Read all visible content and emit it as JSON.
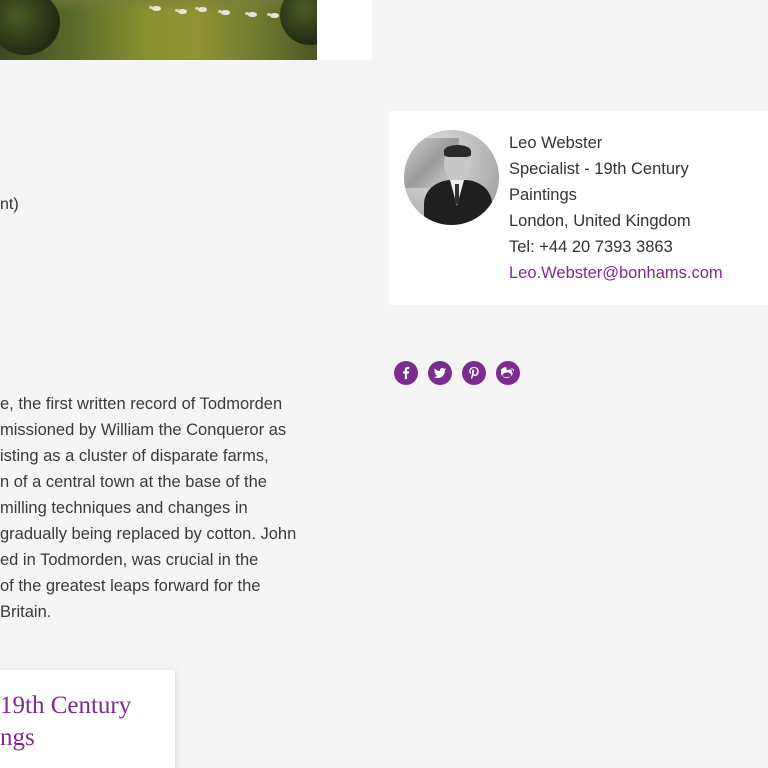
{
  "lot": {
    "meta_fragment": "nt)",
    "description_lines": [
      "e, the first written record of Todmorden",
      "missioned by William the Conqueror as",
      "isting as a cluster of disparate farms,",
      "n of a central town at the base of the",
      " milling techniques and changes in",
      "gradually being replaced by cotton. John",
      "ed in Todmorden, was crucial in the",
      "of the greatest leaps forward for the",
      " Britain."
    ]
  },
  "department": {
    "title_lines": [
      " 19th Century",
      "ngs"
    ],
    "color": "#7a2d8f"
  },
  "specialist": {
    "name": "Leo Webster",
    "title_line1": "Specialist - 19th Century",
    "title_line2": "Paintings",
    "location": "London, United Kingdom",
    "phone": "Tel: +44 20 7393 3863",
    "email": "Leo.Webster@bonhams.com"
  },
  "social": {
    "color": "#7a2d8f",
    "icons": [
      "facebook-icon",
      "twitter-icon",
      "pinterest-icon",
      "weibo-icon"
    ]
  }
}
